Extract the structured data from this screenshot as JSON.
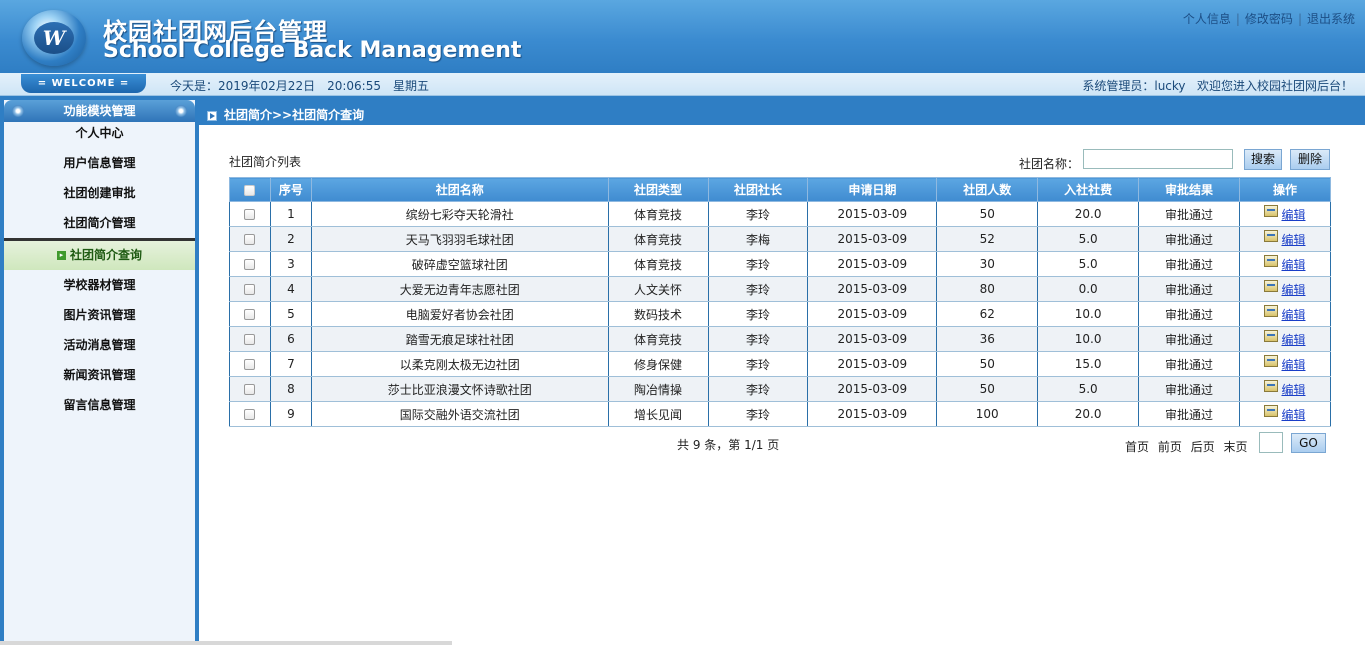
{
  "header": {
    "title_cn": "校园社团网后台管理",
    "title_en": "School College Back Management",
    "logo_letter": "W",
    "links": [
      "个人信息",
      "修改密码",
      "退出系统"
    ],
    "link_separator": "|"
  },
  "infobar": {
    "welcome": "= WELCOME =",
    "date": "今天是：2019年02月22日",
    "time": "20:06:55",
    "weekday": "星期五",
    "admin": "系统管理员：lucky",
    "greeting": "欢迎您进入校园社团网后台！"
  },
  "sidebar": {
    "title": "功能模块管理",
    "items": [
      {
        "label": "个人中心"
      },
      {
        "label": "用户信息管理"
      },
      {
        "label": "社团创建审批"
      },
      {
        "label": "社团简介管理"
      },
      {
        "label": "社团简介查询",
        "active": true
      },
      {
        "label": "学校器材管理"
      },
      {
        "label": "图片资讯管理"
      },
      {
        "label": "活动消息管理"
      },
      {
        "label": "新闻资讯管理"
      },
      {
        "label": "留言信息管理"
      }
    ]
  },
  "main": {
    "breadcrumb": "社团简介>>社团简介查询",
    "list_label": "社团简介列表",
    "search_label": "社团名称：",
    "search_value": "",
    "search_button": "搜索",
    "delete_button": "删除",
    "columns": [
      "序号",
      "社团名称",
      "社团类型",
      "社团社长",
      "申请日期",
      "社团人数",
      "入社社费",
      "审批结果",
      "操作"
    ],
    "edit_label": "编辑",
    "rows": [
      {
        "no": "1",
        "name": "缤纷七彩夺天轮滑社",
        "type": "体育竞技",
        "leader": "李玲",
        "date": "2015-03-09",
        "members": "50",
        "fee": "20.0",
        "status": "审批通过"
      },
      {
        "no": "2",
        "name": "天马飞羽羽毛球社团",
        "type": "体育竞技",
        "leader": "李梅",
        "date": "2015-03-09",
        "members": "52",
        "fee": "5.0",
        "status": "审批通过"
      },
      {
        "no": "3",
        "name": "破碎虚空篮球社团",
        "type": "体育竞技",
        "leader": "李玲",
        "date": "2015-03-09",
        "members": "30",
        "fee": "5.0",
        "status": "审批通过"
      },
      {
        "no": "4",
        "name": "大爱无边青年志愿社团",
        "type": "人文关怀",
        "leader": "李玲",
        "date": "2015-03-09",
        "members": "80",
        "fee": "0.0",
        "status": "审批通过"
      },
      {
        "no": "5",
        "name": "电脑爱好者协会社团",
        "type": "数码技术",
        "leader": "李玲",
        "date": "2015-03-09",
        "members": "62",
        "fee": "10.0",
        "status": "审批通过"
      },
      {
        "no": "6",
        "name": "踏雪无痕足球社社团",
        "type": "体育竞技",
        "leader": "李玲",
        "date": "2015-03-09",
        "members": "36",
        "fee": "10.0",
        "status": "审批通过"
      },
      {
        "no": "7",
        "name": "以柔克刚太极无边社团",
        "type": "修身保健",
        "leader": "李玲",
        "date": "2015-03-09",
        "members": "50",
        "fee": "15.0",
        "status": "审批通过"
      },
      {
        "no": "8",
        "name": "莎士比亚浪漫文怀诗歌社团",
        "type": "陶冶情操",
        "leader": "李玲",
        "date": "2015-03-09",
        "members": "50",
        "fee": "5.0",
        "status": "审批通过"
      },
      {
        "no": "9",
        "name": "国际交融外语交流社团",
        "type": "增长见闻",
        "leader": "李玲",
        "date": "2015-03-09",
        "members": "100",
        "fee": "20.0",
        "status": "审批通过"
      }
    ],
    "pager": {
      "count_text": "共 9 条，第 1/1 页",
      "first": "首页",
      "prev": "前页",
      "next": "后页",
      "last": "末页",
      "page_value": "",
      "go": "GO"
    }
  }
}
